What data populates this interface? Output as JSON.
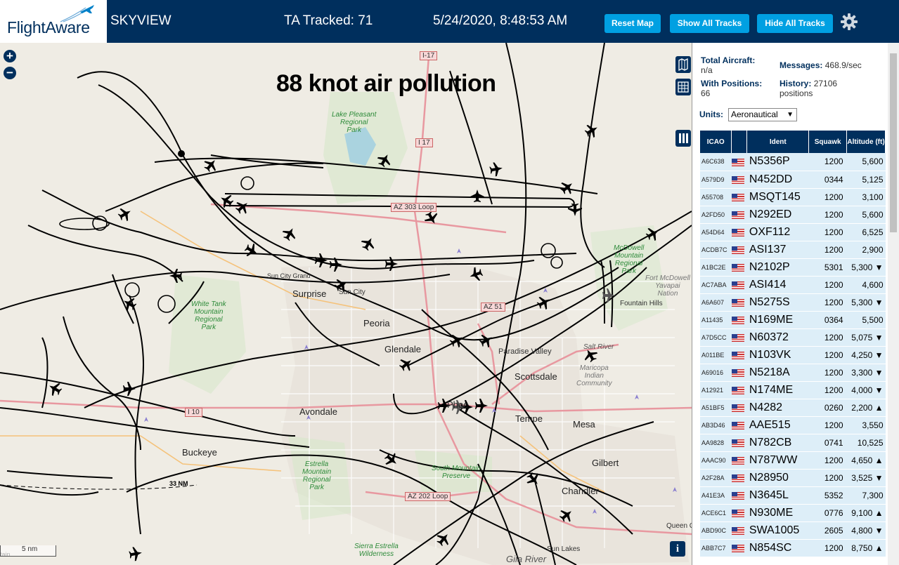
{
  "header": {
    "logo_text": "FlightAware",
    "app_title": "SKYVIEW",
    "ta_tracked": "TA Tracked: 71",
    "clock": "5/24/2020, 8:48:53 AM",
    "buttons": {
      "reset": "Reset Map",
      "show_all": "Show All Tracks",
      "hide_all": "Hide All Tracks"
    },
    "settings_icon": "gear-icon"
  },
  "map": {
    "overlay_title": "88 knot air pollution",
    "zoom_in": "+",
    "zoom_out": "−",
    "scale_label": "5 nm",
    "range_label": "33 NM",
    "info_label": "i",
    "labels": {
      "surprise": "Surprise",
      "sun_city": "Sun City",
      "sun_city_grand": "Sun City Grand",
      "peoria": "Peoria",
      "glendale": "Glendale",
      "paradise_valley": "Paradise Valley",
      "scottsdale": "Scottsdale",
      "fountain_hills": "Fountain Hills",
      "avondale": "Avondale",
      "phoenix": "Phoe",
      "tempe": "Tempe",
      "mesa": "Mesa",
      "gilbert": "Gilbert",
      "chandler": "Chandler",
      "buckeye": "Buckeye",
      "queen_creek": "Queen C",
      "sun_lakes": "Sun Lakes",
      "gila_river": "Gila River",
      "salt_river": "Salt River",
      "lake_pleasant": "Lake Pleasant\nRegional\nPark",
      "white_tank": "White Tank\nMountain\nRegional\nPark",
      "mcdowell": "McDowell\nMountain\nRegional\nPark",
      "fort_mcdowell": "Fort McDowell\nYavapai\nNation",
      "estrella": "Estrella\nMountain\nRegional\nPark",
      "south_mountain": "South Mountain\nPreserve",
      "maricopa": "Maricopa\nIndian\nCommunity",
      "sierra_estrella": "Sierra Estrella\nWilderness",
      "tain": "tain"
    },
    "shields": {
      "i17_top": "I-17",
      "i17": "I 17",
      "az303": "AZ 303 Loop",
      "az51": "AZ 51",
      "i10": "I 10",
      "az202": "AZ 202 Loop"
    },
    "controls": [
      "map-icon",
      "grid-icon",
      "columns-icon"
    ]
  },
  "panel": {
    "total_aircraft_label": "Total Aircraft:",
    "total_aircraft_value": "n/a",
    "with_positions_label": "With Positions:",
    "with_positions_value": "66",
    "messages_label": "Messages:",
    "messages_value": "468.9/sec",
    "history_label": "History:",
    "history_value": "27106",
    "history_unit": "positions",
    "units_label": "Units:",
    "units_value": "Aeronautical",
    "columns": [
      "ICAO",
      "",
      "Ident",
      "Squawk",
      "Altitude (ft)"
    ],
    "rows": [
      {
        "icao": "A6C638",
        "ident": "N5356P",
        "squawk": "1200",
        "alt": "5,600"
      },
      {
        "icao": "A579D9",
        "ident": "N452DD",
        "squawk": "0344",
        "alt": "5,125"
      },
      {
        "icao": "A55708",
        "ident": "MSQT145",
        "squawk": "1200",
        "alt": "3,100"
      },
      {
        "icao": "A2FD50",
        "ident": "N292ED",
        "squawk": "1200",
        "alt": "5,600"
      },
      {
        "icao": "A54D64",
        "ident": "OXF112",
        "squawk": "1200",
        "alt": "6,525"
      },
      {
        "icao": "ACDB7C",
        "ident": "ASI137",
        "squawk": "1200",
        "alt": "2,900"
      },
      {
        "icao": "A1BC2E",
        "ident": "N2102P",
        "squawk": "5301",
        "alt": "5,300 ▼"
      },
      {
        "icao": "AC7ABA",
        "ident": "ASI414",
        "squawk": "1200",
        "alt": "4,600"
      },
      {
        "icao": "A6A607",
        "ident": "N5275S",
        "squawk": "1200",
        "alt": "5,300 ▼"
      },
      {
        "icao": "A11435",
        "ident": "N169ME",
        "squawk": "0364",
        "alt": "5,500"
      },
      {
        "icao": "A7D5CC",
        "ident": "N60372",
        "squawk": "1200",
        "alt": "5,075 ▼"
      },
      {
        "icao": "A011BE",
        "ident": "N103VK",
        "squawk": "1200",
        "alt": "4,250 ▼"
      },
      {
        "icao": "A69016",
        "ident": "N5218A",
        "squawk": "1200",
        "alt": "3,300 ▼"
      },
      {
        "icao": "A12921",
        "ident": "N174ME",
        "squawk": "1200",
        "alt": "4,000 ▼"
      },
      {
        "icao": "A51BF5",
        "ident": "N4282",
        "squawk": "0260",
        "alt": "2,200 ▲"
      },
      {
        "icao": "AB3D46",
        "ident": "AAE515",
        "squawk": "1200",
        "alt": "3,550"
      },
      {
        "icao": "AA9828",
        "ident": "N782CB",
        "squawk": "0741",
        "alt": "10,525"
      },
      {
        "icao": "AAAC90",
        "ident": "N787WW",
        "squawk": "1200",
        "alt": "4,650 ▲"
      },
      {
        "icao": "A2F28A",
        "ident": "N28950",
        "squawk": "1200",
        "alt": "3,525 ▼"
      },
      {
        "icao": "A41E3A",
        "ident": "N3645L",
        "squawk": "5352",
        "alt": "7,300"
      },
      {
        "icao": "ACE6C1",
        "ident": "N930ME",
        "squawk": "0776",
        "alt": "9,100 ▲"
      },
      {
        "icao": "ABD90C",
        "ident": "SWA1005",
        "squawk": "2605",
        "alt": "4,800 ▼"
      },
      {
        "icao": "ABB7C7",
        "ident": "N854SC",
        "squawk": "1200",
        "alt": "8,750 ▲"
      }
    ]
  },
  "colors": {
    "header_bg": "#002f5d",
    "button_bg": "#00a0e2",
    "row_bg": "#ddeef8",
    "map_bg": "#efece4"
  }
}
